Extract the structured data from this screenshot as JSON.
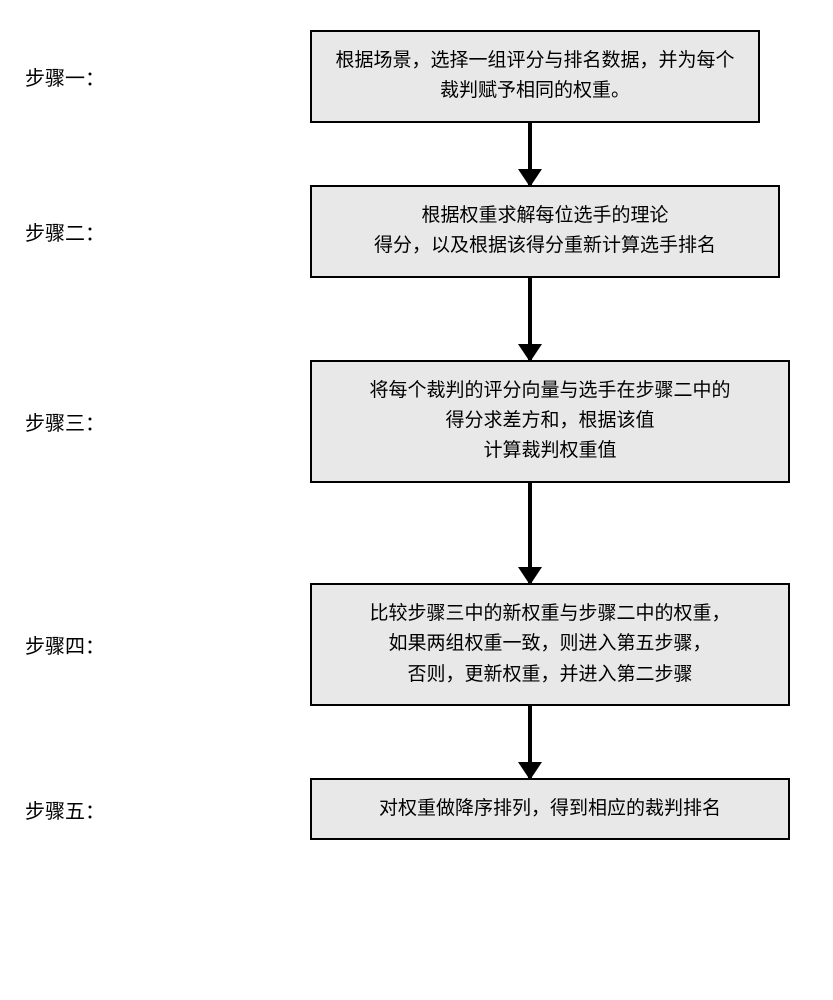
{
  "steps": [
    {
      "label": "步骤一：",
      "text": "根据场景，选择一组评分与排名数据，并为每个裁判赋予相同的权重。"
    },
    {
      "label": "步骤二：",
      "text": "根据权重求解每位选手的理论\n得分，以及根据该得分重新计算选手排名"
    },
    {
      "label": "步骤三：",
      "text": "将每个裁判的评分向量与选手在步骤二中的\n得分求差方和，根据该值\n计算裁判权重值"
    },
    {
      "label": "步骤四：",
      "text": "比较步骤三中的新权重与步骤二中的权重，\n如果两组权重一致，则进入第五步骤，\n否则，更新权重，并进入第二步骤"
    },
    {
      "label": "步骤五：",
      "text": "对权重做降序排列，得到相应的裁判排名"
    }
  ],
  "chart_data": {
    "type": "flowchart",
    "direction": "top-down",
    "nodes": [
      {
        "id": "s1",
        "label": "步骤一",
        "text": "根据场景，选择一组评分与排名数据，并为每个裁判赋予相同的权重。"
      },
      {
        "id": "s2",
        "label": "步骤二",
        "text": "根据权重求解每位选手的理论得分，以及根据该得分重新计算选手排名"
      },
      {
        "id": "s3",
        "label": "步骤三",
        "text": "将每个裁判的评分向量与选手在步骤二中的得分求差方和，根据该值计算裁判权重值"
      },
      {
        "id": "s4",
        "label": "步骤四",
        "text": "比较步骤三中的新权重与步骤二中的权重，如果两组权重一致，则进入第五步骤，否则，更新权重，并进入第二步骤"
      },
      {
        "id": "s5",
        "label": "步骤五",
        "text": "对权重做降序排列，得到相应的裁判排名"
      }
    ],
    "edges": [
      {
        "from": "s1",
        "to": "s2"
      },
      {
        "from": "s2",
        "to": "s3"
      },
      {
        "from": "s3",
        "to": "s4"
      },
      {
        "from": "s4",
        "to": "s5"
      }
    ]
  }
}
